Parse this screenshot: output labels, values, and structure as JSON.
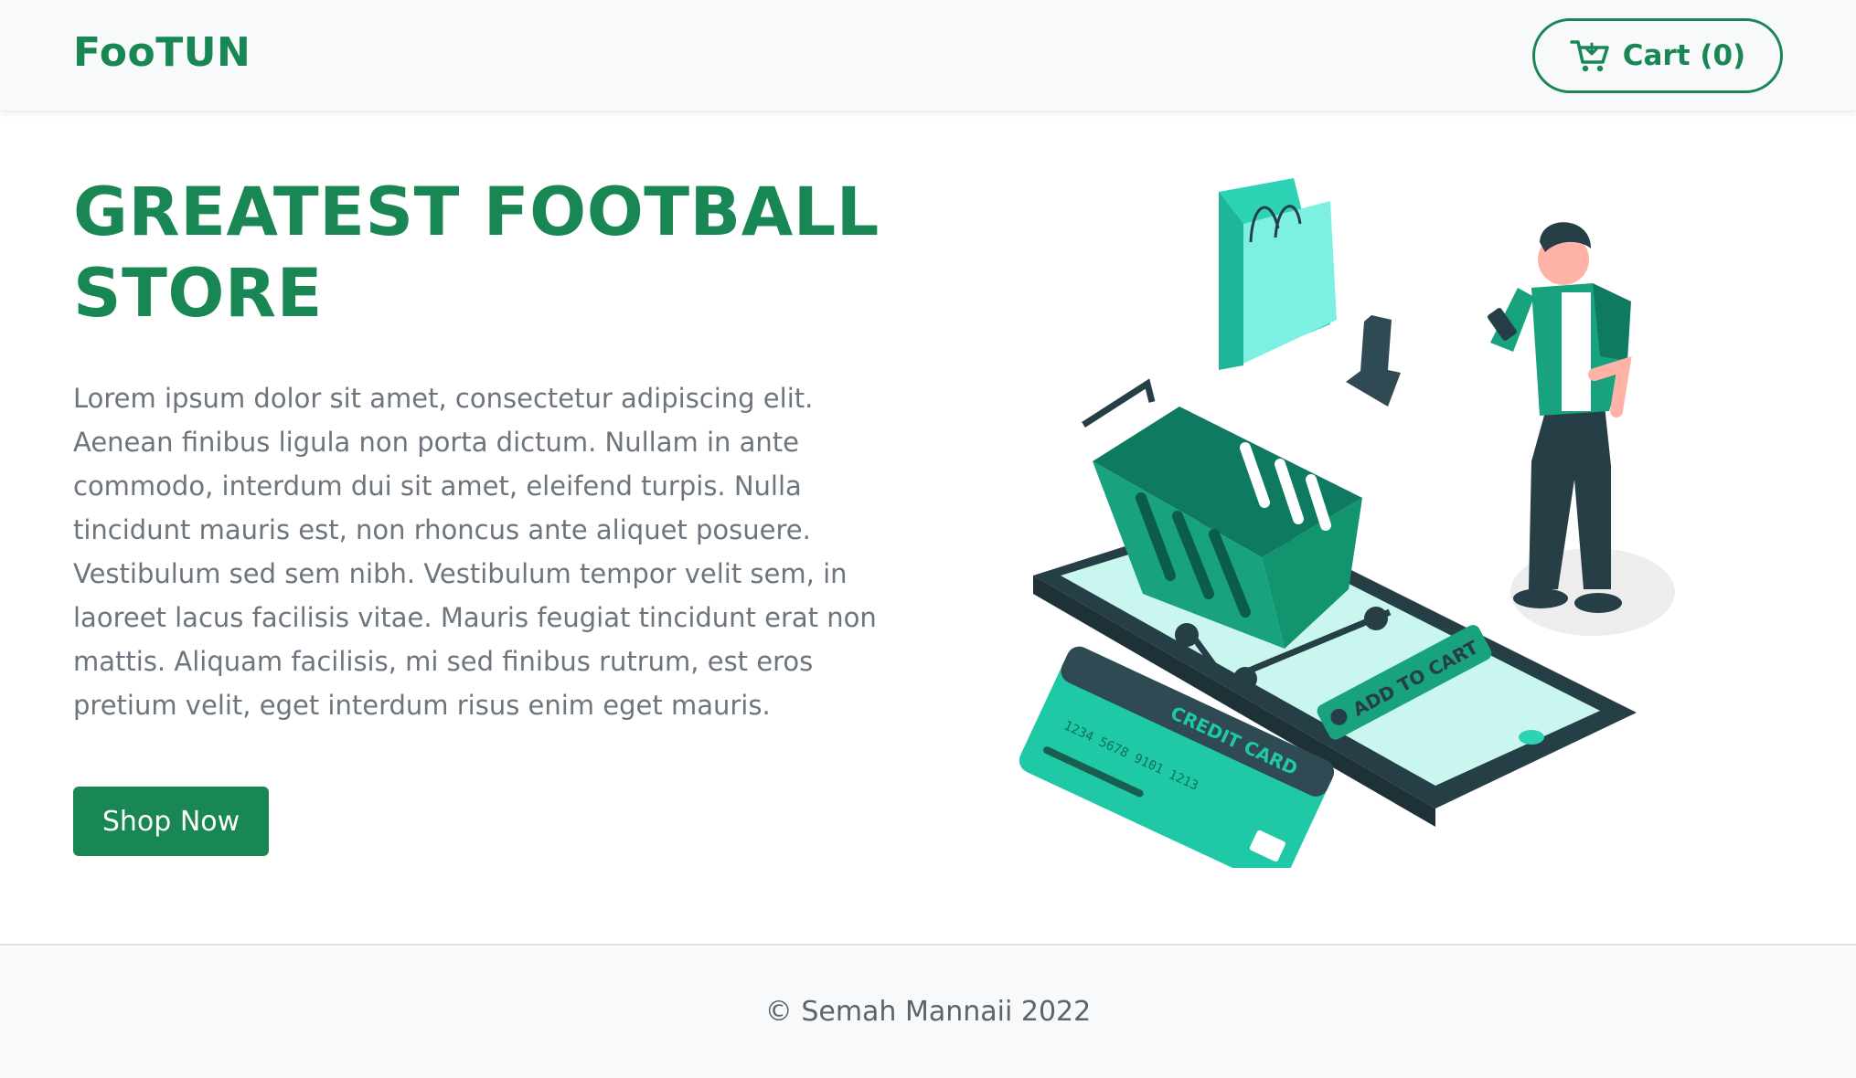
{
  "navbar": {
    "brand": "FooTUN",
    "cart_label": "Cart (0)",
    "cart_icon": "cart-icon"
  },
  "hero": {
    "title": "GREATEST FOOTBALL STORE",
    "text": "Lorem ipsum dolor sit amet, consectetur adipiscing elit. Aenean finibus ligula non porta dictum. Nullam in ante commodo, interdum dui sit amet, eleifend turpis. Nulla tincidunt mauris est, non rhoncus ante aliquet posuere. Vestibulum sed sem nibh. Vestibulum tempor velit sem, in laoreet lacus facilisis vitae. Mauris feugiat tincidunt erat non mattis. Aliquam facilisis, mi sed finibus rutrum, est eros pretium velit, eget interdum risus enim eget mauris.",
    "button_label": "Shop Now"
  },
  "illustration": {
    "card_title": "CREDIT CARD",
    "card_number": "1234 5678 9101 1213",
    "add_to_cart": "ADD TO CART",
    "colors": {
      "accent": "#198754",
      "teal": "#2ed3b5",
      "dark": "#2f4a52"
    }
  },
  "footer": {
    "copyright": "© Semah Mannaii 2022"
  }
}
